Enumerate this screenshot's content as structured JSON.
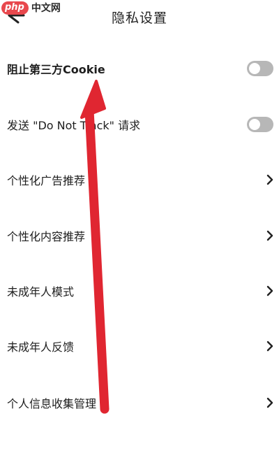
{
  "watermark": {
    "logo": "php",
    "text": "中文网"
  },
  "header": {
    "title": "隐私设置",
    "back_icon": "back-arrow-icon"
  },
  "settings": [
    {
      "label": "阻止第三方Cookie",
      "control": "toggle",
      "enabled": false
    },
    {
      "label": "发送 \"Do Not Track\" 请求",
      "control": "toggle",
      "enabled": false
    },
    {
      "label": "个性化广告推荐",
      "control": "chevron"
    },
    {
      "label": "个性化内容推荐",
      "control": "chevron"
    },
    {
      "label": "未成年人模式",
      "control": "chevron"
    },
    {
      "label": "未成年人反馈",
      "control": "chevron"
    },
    {
      "label": "个人信息收集管理",
      "control": "chevron"
    }
  ],
  "colors": {
    "annotation_arrow": "#e02631",
    "toggle_off": "#b7b7b7",
    "text": "#1e1e1e"
  }
}
